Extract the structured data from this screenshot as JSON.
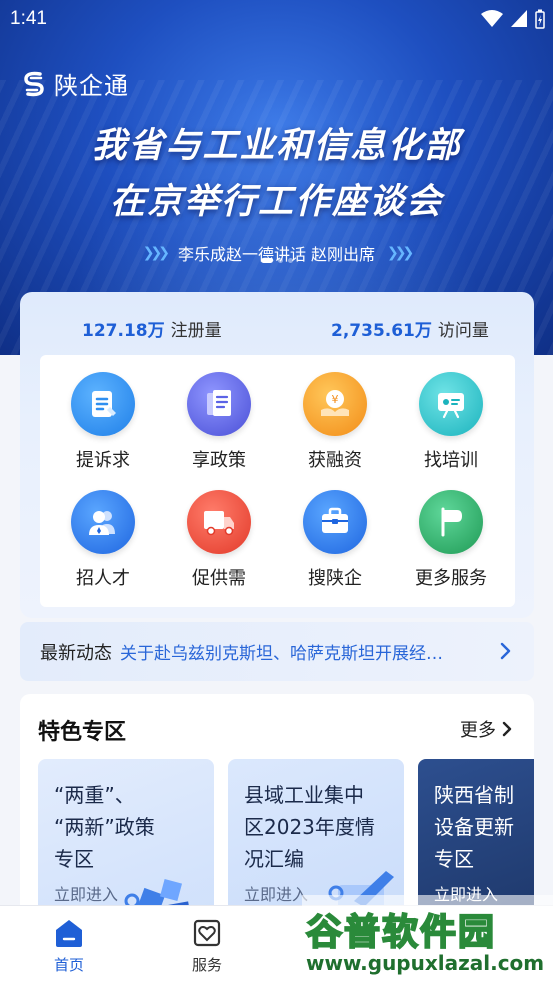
{
  "status": {
    "time": "1:41"
  },
  "brand": {
    "name": "陕企通"
  },
  "banner": {
    "headline_1": "我省与工业和信息化部",
    "headline_2": "在京举行工作座谈会",
    "subline": "李乐成赵一德讲话 赵刚出席"
  },
  "stats": [
    {
      "value": "127.18万",
      "label": "注册量"
    },
    {
      "value": "2,735.61万",
      "label": "访问量"
    }
  ],
  "services": [
    {
      "label": "提诉求",
      "icon": "document-icon",
      "color": "#2f8ff0"
    },
    {
      "label": "享政策",
      "icon": "files-icon",
      "color": "#5b63e6"
    },
    {
      "label": "获融资",
      "icon": "money-bag-icon",
      "color": "#f5a623"
    },
    {
      "label": "找培训",
      "icon": "training-board-icon",
      "color": "#27c2c9"
    },
    {
      "label": "招人才",
      "icon": "people-icon",
      "color": "#2f7ff0"
    },
    {
      "label": "促供需",
      "icon": "truck-icon",
      "color": "#ef5443"
    },
    {
      "label": "搜陕企",
      "icon": "briefcase-icon",
      "color": "#2f7ff0"
    },
    {
      "label": "更多服务",
      "icon": "flag-icon",
      "color": "#2db36b"
    }
  ],
  "news": {
    "label": "最新动态",
    "text": "关于赴乌兹别克斯坦、哈萨克斯坦开展经…"
  },
  "feature": {
    "title": "特色专区",
    "more": "更多",
    "cards": [
      {
        "line1": "“两重”、",
        "line2": "“两新”政策",
        "line3": "专区",
        "enter": "立即进入"
      },
      {
        "line1": "县域工业集中",
        "line2": "区2023年度情",
        "line3": "况汇编",
        "enter": "立即进入"
      },
      {
        "line1": "陕西省制",
        "line2": "设备更新",
        "line3": "专区",
        "enter": "立即进入"
      }
    ]
  },
  "nav": [
    {
      "label": "首页",
      "icon": "home-icon",
      "active": true
    },
    {
      "label": "服务",
      "icon": "service-heart-icon",
      "active": false
    }
  ],
  "watermark": {
    "big": "谷普软件园",
    "small": "www.gupuxlazal.com"
  },
  "colors": {
    "primary": "#1f5fd6",
    "banner": "#1e4fc0"
  }
}
